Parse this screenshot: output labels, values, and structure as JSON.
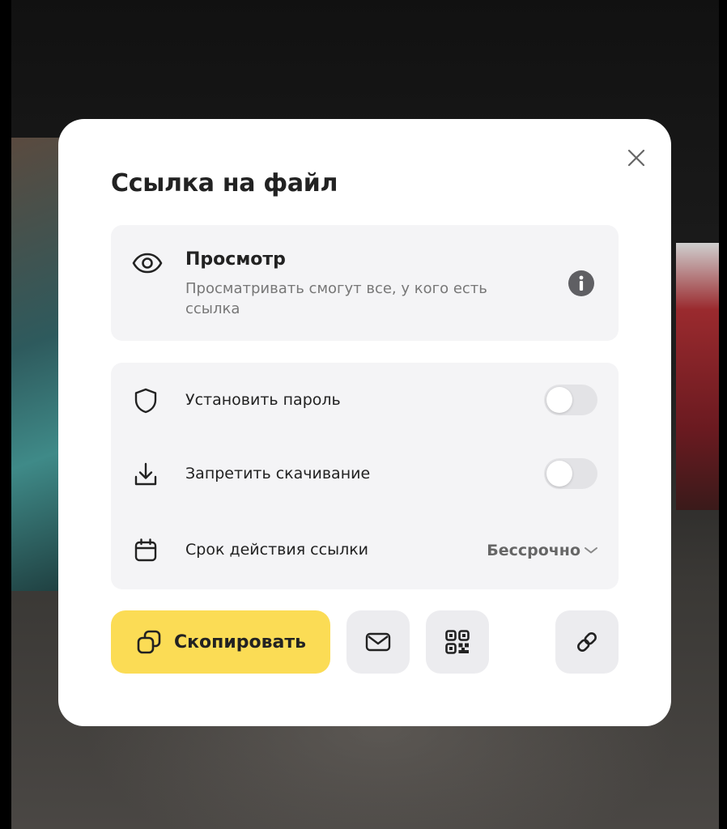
{
  "dialog": {
    "title": "Ссылка на файл",
    "close_icon": "close-icon"
  },
  "access": {
    "icon": "eye-icon",
    "title": "Просмотр",
    "description": "Просматривать смогут все, у кого есть ссылка",
    "info_icon": "info-icon"
  },
  "settings": {
    "password": {
      "icon": "shield-icon",
      "label": "Установить пароль",
      "enabled": false
    },
    "no_download": {
      "icon": "download-icon",
      "label": "Запретить скачивание",
      "enabled": false
    },
    "expiry": {
      "icon": "calendar-icon",
      "label": "Срок действия ссылки",
      "value": "Бессрочно"
    }
  },
  "actions": {
    "copy_label": "Скопировать",
    "copy_icon": "copy-icon",
    "email_icon": "mail-icon",
    "qr_icon": "qr-code-icon",
    "link_icon": "link-icon"
  },
  "colors": {
    "accent": "#fbdc55",
    "card_background": "#f4f4f6",
    "dialog_background": "#ffffff"
  }
}
